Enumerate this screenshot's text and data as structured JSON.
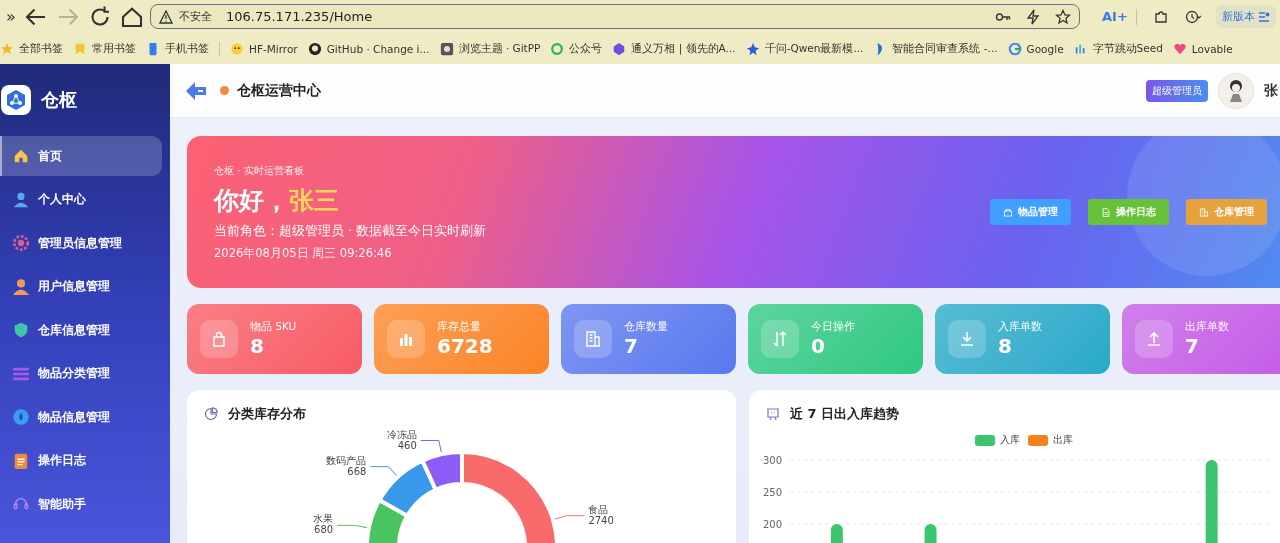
{
  "browser": {
    "overflow": "»",
    "forward": {
      "disabled": true
    },
    "address": {
      "security": "不安全",
      "url": "106.75.171.235/Home"
    },
    "ai_label": "AI+",
    "update_button": "新版本"
  },
  "bookmarks": [
    {
      "label": "全部书签",
      "kind": "star"
    },
    {
      "label": "常用书签",
      "kind": "folder"
    },
    {
      "label": "手机书签",
      "kind": "phone"
    },
    {
      "label": "HF-Mirror",
      "kind": "hf"
    },
    {
      "label": "GitHub · Change i...",
      "kind": "github"
    },
    {
      "label": "浏览主题 · GitPP",
      "kind": "theme"
    },
    {
      "label": "公众号",
      "kind": "ring"
    },
    {
      "label": "通义万相 | 领先的A...",
      "kind": "tongyi"
    },
    {
      "label": "千问-Qwen最新模...",
      "kind": "qwen"
    },
    {
      "label": "智能合同审查系统 -...",
      "kind": "doc"
    },
    {
      "label": "Google",
      "kind": "google"
    },
    {
      "label": "字节跳动Seed",
      "kind": "seed"
    },
    {
      "label": "Lovable",
      "kind": "heart"
    }
  ],
  "sidebar": {
    "brand": "仓枢",
    "items": [
      {
        "label": "首页",
        "kind": "home",
        "selected": true
      },
      {
        "label": "个人中心",
        "kind": "user",
        "selected": false
      },
      {
        "label": "管理员信息管理",
        "kind": "gear",
        "selected": false
      },
      {
        "label": "用户信息管理",
        "kind": "person",
        "selected": false
      },
      {
        "label": "仓库信息管理",
        "kind": "shield",
        "selected": false
      },
      {
        "label": "物品分类管理",
        "kind": "list",
        "selected": false
      },
      {
        "label": "物品信息管理",
        "kind": "drop",
        "selected": false
      },
      {
        "label": "操作日志",
        "kind": "log",
        "selected": false
      },
      {
        "label": "智能助手",
        "kind": "headset",
        "selected": false
      }
    ]
  },
  "header": {
    "title": "仓枢运营中心",
    "role_badge": "超级管理员",
    "user_name": "张"
  },
  "banner": {
    "eyebrow": "仓枢 · 实时运营看板",
    "greeting": "你好，",
    "user": "张三",
    "role_line": "当前角色：超级管理员 · 数据截至今日实时刷新",
    "datetime": "2026年08月05日 周三 09:26:46",
    "buttons": [
      {
        "label": "物品管理",
        "kind": "box",
        "color": "#409eff"
      },
      {
        "label": "操作日志",
        "kind": "doc",
        "color": "#67c23a"
      },
      {
        "label": "仓库管理",
        "kind": "building",
        "color": "#e6a23c"
      }
    ]
  },
  "stats": [
    {
      "label": "物品 SKU",
      "value": "8",
      "kind": "bag",
      "color": "#f85a64"
    },
    {
      "label": "库存总量",
      "value": "6728",
      "kind": "bars",
      "color": "#fb8424"
    },
    {
      "label": "仓库数量",
      "value": "7",
      "kind": "building",
      "color": "#5a78ee"
    },
    {
      "label": "今日操作",
      "value": "0",
      "kind": "swap",
      "color": "#2dc882"
    },
    {
      "label": "入库单数",
      "value": "8",
      "kind": "download",
      "color": "#27a9c9"
    },
    {
      "label": "出库单数",
      "value": "7",
      "kind": "upload",
      "color": "#c45be6"
    }
  ],
  "category_chart": {
    "title": "分类库存分布",
    "chart_data": {
      "type": "donut",
      "categories": [
        "食品",
        "水果",
        "数码产品",
        "冷冻品"
      ],
      "values": [
        2740,
        680,
        668,
        460
      ],
      "data_labels": true
    }
  },
  "trend_chart": {
    "title": "近 7 日出入库趋势",
    "chart_data": {
      "type": "bar",
      "ylim": [
        0,
        300
      ],
      "yticks": [
        200,
        250,
        300
      ],
      "series": [
        {
          "name": "入库",
          "color": "#3cc46e",
          "values": [
            200,
            200,
            null,
            null,
            300
          ]
        },
        {
          "name": "出库",
          "color": "#f5821f",
          "values": [
            null,
            null,
            null,
            null,
            null
          ]
        }
      ]
    }
  }
}
